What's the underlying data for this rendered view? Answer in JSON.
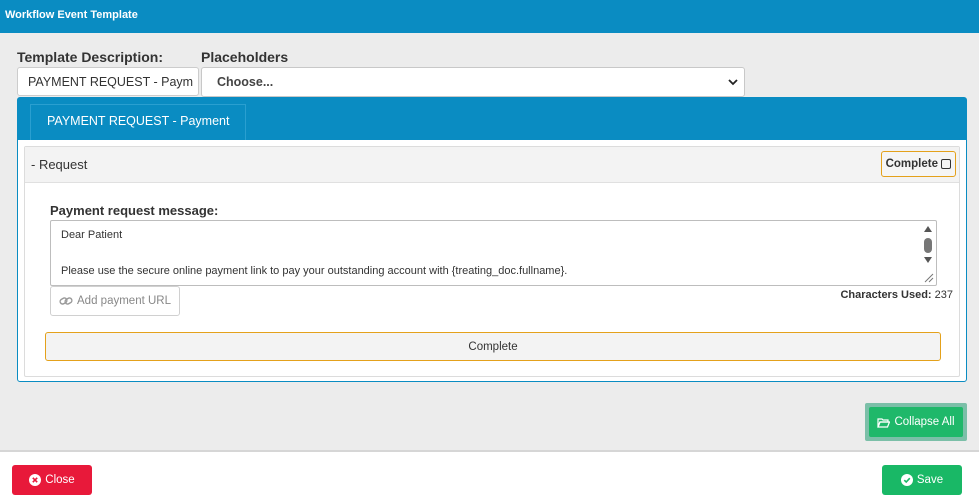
{
  "dialog": {
    "title": "Workflow Event Template"
  },
  "form": {
    "description_label": "Template Description:",
    "description_value": "PAYMENT REQUEST - Paym",
    "placeholders_label": "Placeholders",
    "placeholders_selected": "Choose..."
  },
  "panel": {
    "tab_label": "PAYMENT REQUEST - Payment",
    "section": {
      "title": "-  Request",
      "complete_checkbox_label": "Complete",
      "complete_checked": false,
      "message_label": "Payment request message:",
      "message_line1": "Dear Patient",
      "message_line2": "Please use the secure online payment link to pay your outstanding account with  {treating_doc.fullname}.",
      "add_url_label": "Add payment URL",
      "chars_label": "Characters Used:",
      "chars_value": "237",
      "complete_button": "Complete"
    }
  },
  "actions": {
    "collapse_all": "Collapse All",
    "close": "Close",
    "save": "Save"
  },
  "colors": {
    "header": "#0a8cc2",
    "accent_orange": "#e4a11b",
    "green": "#19b866",
    "red": "#e8193a"
  }
}
